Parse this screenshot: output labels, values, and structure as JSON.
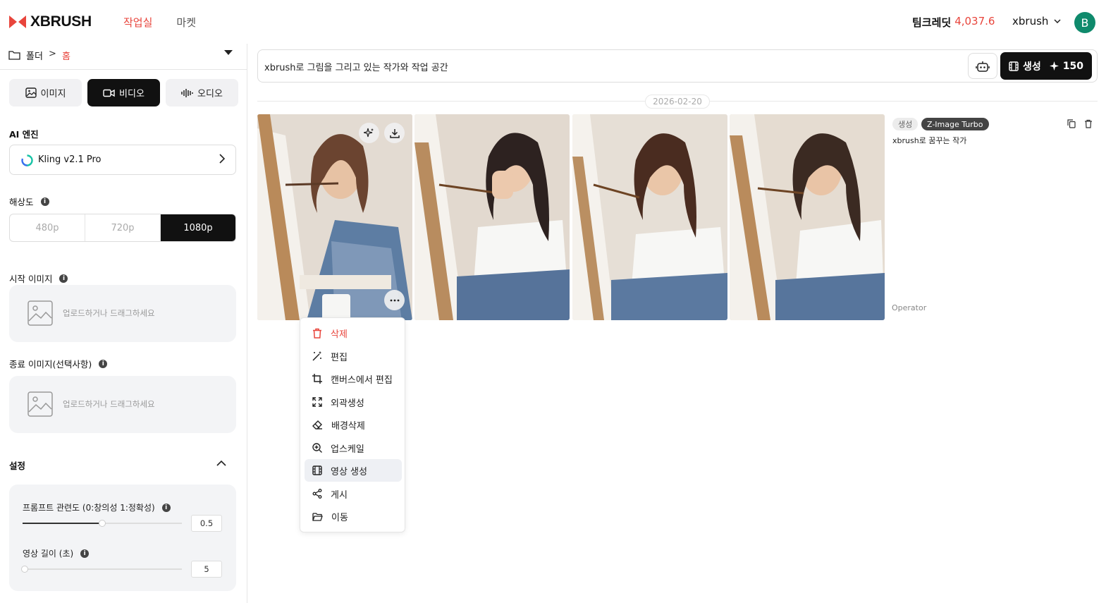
{
  "header": {
    "brand": "XBRUSH",
    "nav": {
      "workroom": "작업실",
      "market": "마켓"
    },
    "credit_label": "팀크레딧",
    "credit_value": "4,037.6",
    "username": "xbrush",
    "avatar_initial": "B"
  },
  "sidebar": {
    "folder_label": "폴더",
    "breadcrumb_sep": ">",
    "home_label": "홈",
    "media_tabs": {
      "image": "이미지",
      "video": "비디오",
      "audio": "오디오"
    },
    "selected_tab": "video",
    "ai_engine_label": "AI 엔진",
    "ai_engine_value": "Kling v2.1 Pro",
    "resolution_label": "해상도",
    "resolutions": [
      "480p",
      "720p",
      "1080p"
    ],
    "selected_resolution": "1080p",
    "start_image_label": "시작 이미지",
    "end_image_label": "종료 이미지(선택사항)",
    "upload_hint": "업로드하거나 드래그하세요",
    "settings_label": "설정",
    "prompt_relevance_label": "프롬프트 관련도 (0:창의성 1:정확성)",
    "prompt_relevance_value": "0.5",
    "prompt_relevance_fraction": 0.5,
    "video_length_label": "영상 길이 (초)",
    "video_length_value": "5",
    "video_length_fraction": 0
  },
  "main": {
    "prompt_text": "xbrush로 그림을 그리고 있는 작가와 작업 공간",
    "generate_label": "생성",
    "generate_cost": "150",
    "date": "2026-02-20",
    "tag_generate": "생성",
    "tag_model": "Z-Image Turbo",
    "description": "xbrush로 꿈꾸는 작가",
    "operator": "Operator"
  },
  "context_menu": {
    "items": [
      "삭제",
      "편집",
      "캔버스에서 편집",
      "외곽생성",
      "배경삭제",
      "업스케일",
      "영상 생성",
      "게시",
      "이동"
    ],
    "highlighted": "영상 생성"
  },
  "colors": {
    "accent": "#e8453c",
    "dark": "#111111",
    "avatar": "#0f8a6c"
  }
}
